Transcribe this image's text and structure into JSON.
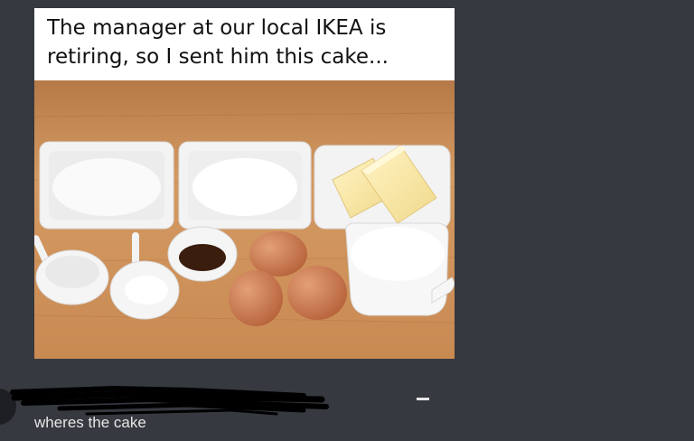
{
  "post": {
    "caption": "The manager at our local IKEA is retiring, so I sent him this cake...",
    "image_subject": "cake-ingredients-photo"
  },
  "comment": {
    "author_scribbled": true,
    "text": "wheres the cake"
  },
  "colors": {
    "background": "#36393f",
    "caption_bg": "#ffffff",
    "table_wood": "#c98c55",
    "comment_text": "#e6e6e6"
  }
}
